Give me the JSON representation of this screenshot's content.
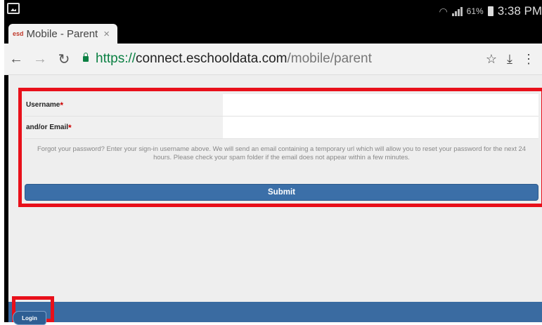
{
  "statusbar": {
    "battery_percent": "61%",
    "time": "3:38 PM"
  },
  "browser": {
    "tab_title": "Mobile - Parent",
    "tab_close": "×",
    "url_scheme": "https://",
    "url_host": "connect.eschooldata.com",
    "url_path": "/mobile/parent"
  },
  "form": {
    "username_label": "Username",
    "email_label": "and/or Email",
    "required_mark": "*",
    "username_value": "",
    "email_value": "",
    "help_text": "Forgot your password? Enter your sign-in username above. We will send an email containing a temporary url which will allow you to reset your password for the next 24 hours. Please check your spam folder if the email does not appear within a few minutes.",
    "submit_label": "Submit"
  },
  "footer": {
    "login_label": "Login"
  },
  "colors": {
    "highlight": "#e8101a",
    "primary": "#3b6fa8",
    "secure_green": "#0b8043"
  }
}
